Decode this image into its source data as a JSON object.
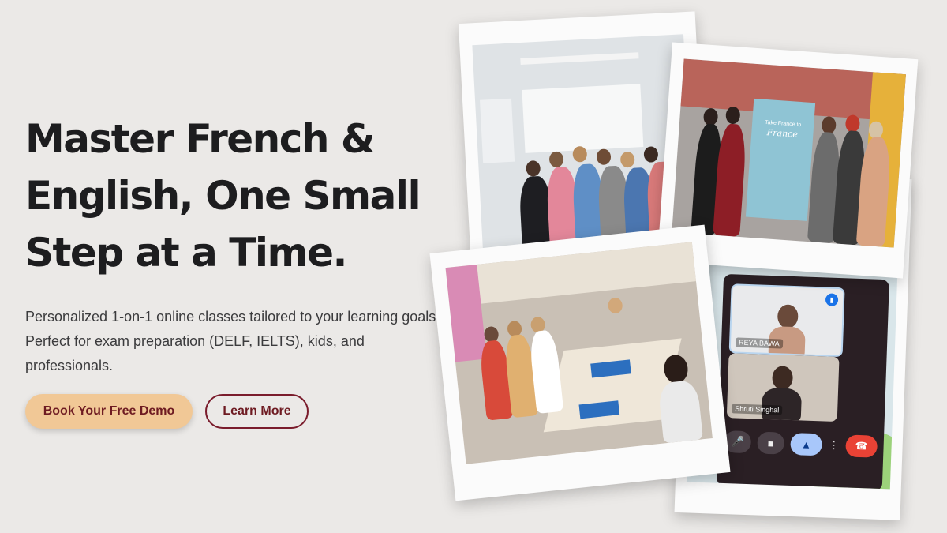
{
  "hero": {
    "headline_line1": "Master French &",
    "headline_line2": "English, One Small",
    "headline_line3": "Step at a Time.",
    "subtitle": "Personalized 1-on-1 online classes tailored to your learning goals. Perfect for exam preparation (DELF, IELTS), kids, and professionals.",
    "primary_button": "Book Your Free Demo",
    "secondary_button": "Learn More"
  },
  "photos": {
    "event_banner_small": "Take France to",
    "event_banner_title": "France",
    "video_call": {
      "participant_1": "REYA BAWA",
      "participant_2": "Shruti Singhal"
    }
  },
  "colors": {
    "background": "#ebe9e7",
    "primary_button_bg": "#f1c896",
    "brand_maroon": "#6e1b22",
    "end_call_red": "#e94235"
  },
  "icons": {
    "mic": "mic-icon",
    "camera": "camera-icon",
    "present": "present-screen-icon",
    "more": "more-vertical-icon",
    "end_call": "end-call-icon",
    "audio": "audio-level-icon"
  }
}
